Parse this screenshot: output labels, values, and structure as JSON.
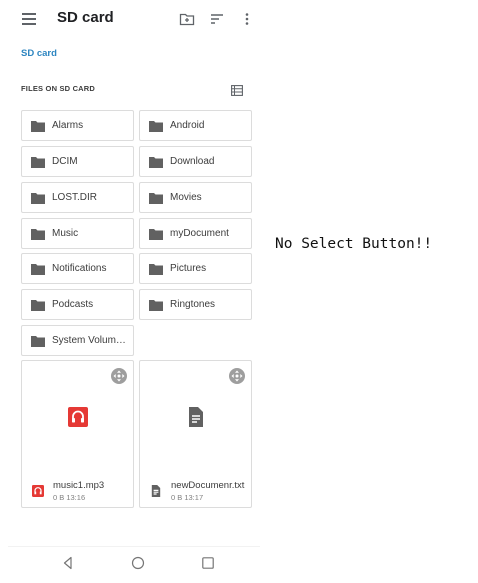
{
  "topbar": {
    "title": "SD card",
    "icons": [
      "menu-icon",
      "new-folder-icon",
      "sort-icon",
      "more-vert-icon"
    ]
  },
  "breadcrumb": "SD card",
  "section": {
    "header": "FILES ON SD CARD",
    "view_icon": "list-view-icon"
  },
  "folders": [
    "Alarms",
    "Android",
    "DCIM",
    "Download",
    "LOST.DIR",
    "Movies",
    "Music",
    "myDocument",
    "Notifications",
    "Pictures",
    "Podcasts",
    "Ringtones",
    "System Volume Information"
  ],
  "files": [
    {
      "name": "music1.mp3",
      "meta": "0 B 13:16",
      "icon": "audio-file-icon",
      "accent": "#e53935"
    },
    {
      "name": "newDocumenr.txt",
      "meta": "0 B 13:17",
      "icon": "document-icon",
      "accent": "#616161"
    }
  ],
  "navbar": [
    "back-icon",
    "home-icon",
    "recents-icon"
  ],
  "annotation": "No Select Button!!",
  "colors": {
    "folder": "#616161",
    "link": "#2e86c1",
    "border": "#dcdcdc"
  }
}
